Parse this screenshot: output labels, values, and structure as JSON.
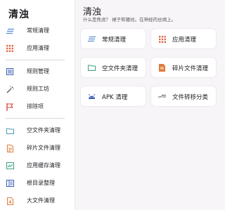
{
  "sidebar": {
    "title": "清浊",
    "items": [
      {
        "label": "常规清理",
        "icon": "lines-icon",
        "color": "#5b8fd6"
      },
      {
        "label": "应用清理",
        "icon": "grid-icon",
        "color": "#e06a4b"
      },
      {
        "label": "规则管理",
        "icon": "list-icon",
        "color": "#3b5fb3"
      },
      {
        "label": "规则工坊",
        "icon": "magic-wand-icon",
        "color": "#555259"
      },
      {
        "label": "排除项",
        "icon": "flag-icon",
        "color": "#d64541"
      },
      {
        "label": "空文件夹清理",
        "icon": "folder-icon",
        "color": "#4a9db5"
      },
      {
        "label": "碎片文件清理",
        "icon": "document-icon",
        "color": "#e07b3a"
      },
      {
        "label": "应用缓存清理",
        "icon": "cache-icon",
        "color": "#3aa37a"
      },
      {
        "label": "根目录整理",
        "icon": "directory-icon",
        "color": "#3b5fb3"
      },
      {
        "label": "大文件清理",
        "icon": "large-file-icon",
        "color": "#e07b3a"
      }
    ]
  },
  "main": {
    "title": "清浊",
    "subtitle": "什么是焦虑？ 裙子和辘纹。在神经的丝绸上。",
    "cards": [
      {
        "label": "常规清理",
        "icon": "lines-icon",
        "color": "#5b8fd6"
      },
      {
        "label": "应用清理",
        "icon": "grid-icon",
        "color": "#e06a4b"
      },
      {
        "label": "空文件夹清理",
        "icon": "folder-icon",
        "color": "#3aa37a"
      },
      {
        "label": "碎片文件清理",
        "icon": "document-icon",
        "color": "#e07b3a"
      },
      {
        "label": "APK 清理",
        "icon": "android-icon",
        "color": "#3b5fb3"
      },
      {
        "label": "文件转移分类",
        "icon": "transfer-icon",
        "color": "#555259"
      }
    ]
  }
}
